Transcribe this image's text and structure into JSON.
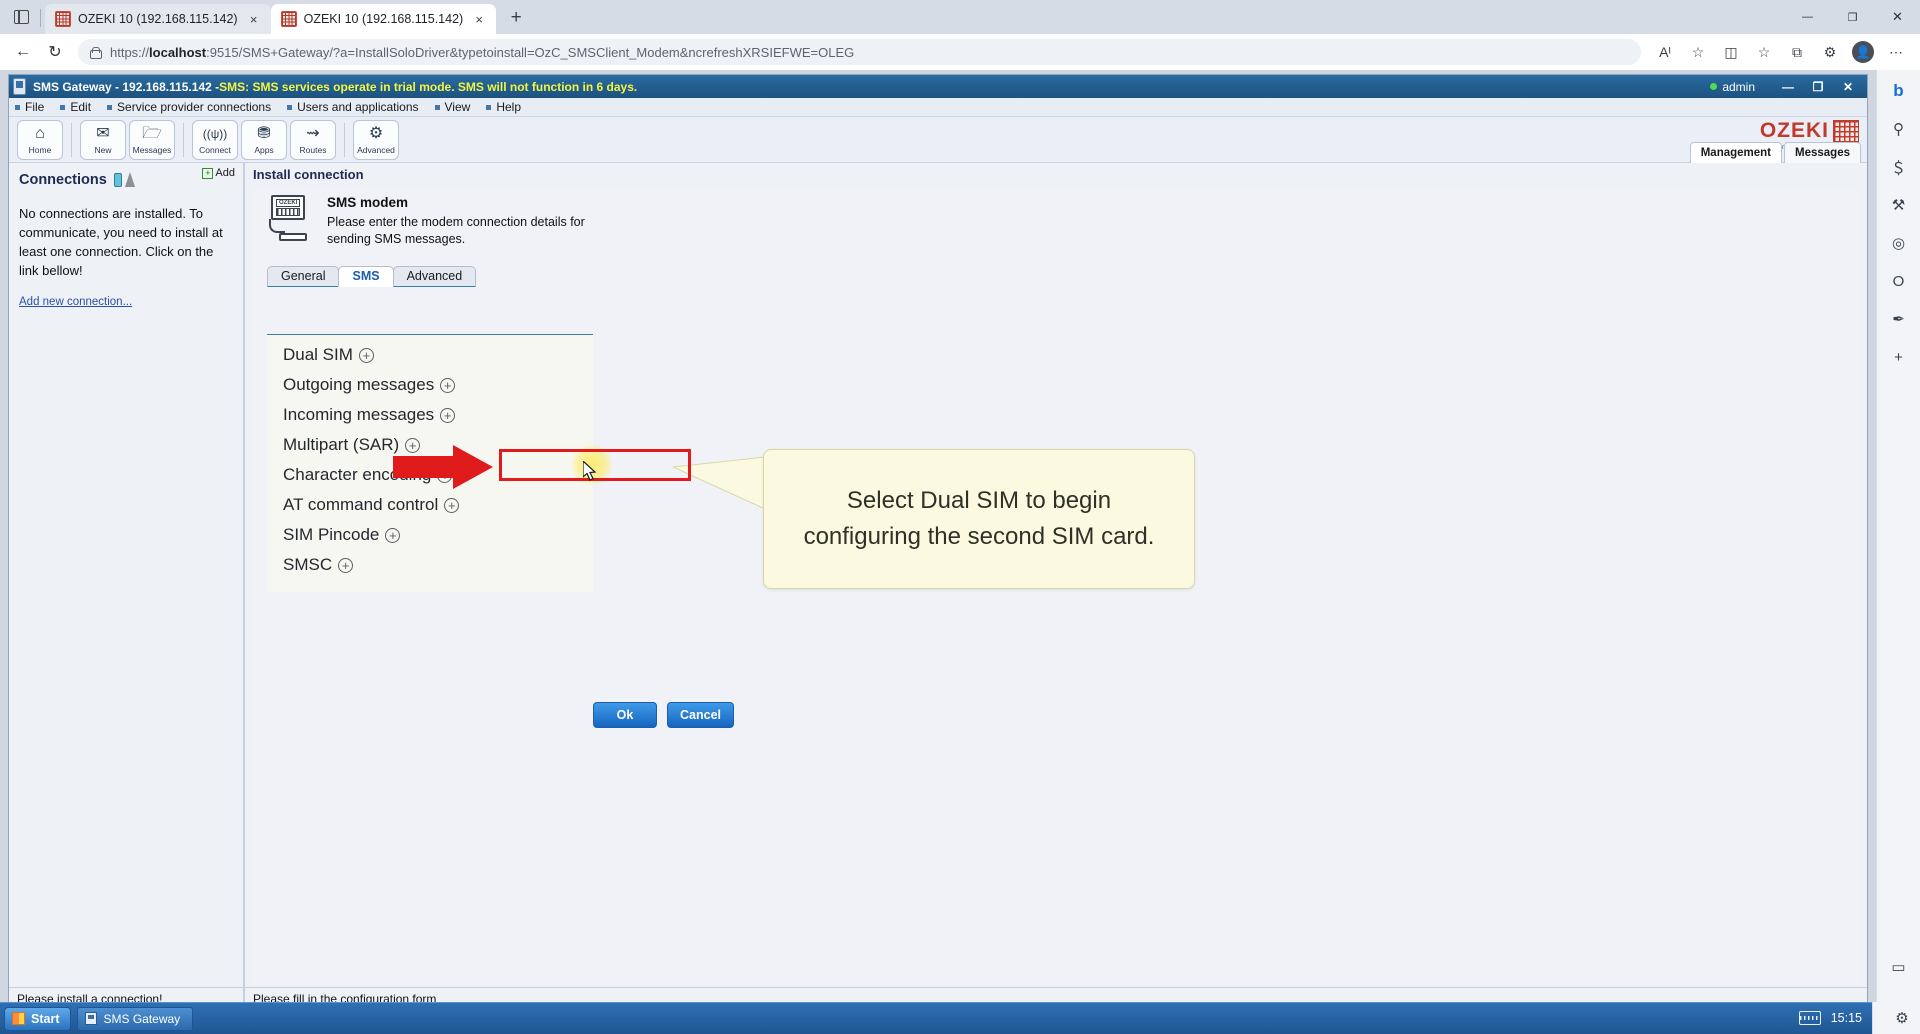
{
  "browser": {
    "tabs": [
      {
        "title": "OZEKI 10 (192.168.115.142)",
        "active": false
      },
      {
        "title": "OZEKI 10 (192.168.115.142)",
        "active": true
      }
    ],
    "new_tab_label": "+",
    "close_glyph": "×",
    "window_controls": {
      "minimize": "—",
      "maximize": "❐",
      "close": "✕"
    },
    "nav": {
      "back": "←",
      "reload": "↻"
    },
    "address": {
      "scheme": "https://",
      "host": "localhost",
      "rest": ":9515/SMS+Gateway/?a=InstallSoloDriver&typetoinstall=OzC_SMSClient_Modem&ncrefreshXRSIEFWE=OLEG",
      "full": "https://localhost:9515/SMS+Gateway/?a=InstallSoloDriver&typetoinstall=OzC_SMSClient_Modem&ncrefreshXRSIEFWE=OLEG"
    },
    "nav_icons": [
      {
        "name": "read-aloud-icon",
        "glyph": "Aᴵ"
      },
      {
        "name": "favorite-star-icon",
        "glyph": "☆"
      },
      {
        "name": "split-screen-icon",
        "glyph": "◫"
      },
      {
        "name": "favorites-icon",
        "glyph": "☆"
      },
      {
        "name": "collections-icon",
        "glyph": "⧉"
      },
      {
        "name": "browser-essentials-icon",
        "glyph": "⚙"
      },
      {
        "name": "profile-icon",
        "glyph": "●"
      },
      {
        "name": "settings-more-icon",
        "glyph": "⋯"
      }
    ],
    "edge_sidebar": [
      {
        "name": "copilot-icon",
        "glyph": "b"
      },
      {
        "name": "search-icon",
        "glyph": "⚲"
      },
      {
        "name": "shopping-icon",
        "glyph": "＄"
      },
      {
        "name": "tools-icon",
        "glyph": "⚒"
      },
      {
        "name": "games-icon",
        "glyph": "◎"
      },
      {
        "name": "outlook-icon",
        "glyph": "O"
      },
      {
        "name": "drop-icon",
        "glyph": "✒"
      },
      {
        "name": "add-tool-icon",
        "glyph": "+"
      },
      {
        "name": "phone-link-icon",
        "glyph": "▭"
      },
      {
        "name": "sidebar-settings-icon",
        "glyph": "⚙"
      }
    ]
  },
  "app": {
    "title_prefix": "SMS Gateway - 192.168.115.142 - ",
    "title_warning": "SMS: SMS services operate in trial mode. SMS will not function in 6 days.",
    "user": "admin",
    "window_controls": {
      "minimize": "—",
      "maximize": "❐",
      "close": "✕"
    },
    "menu": [
      {
        "label": "File"
      },
      {
        "label": "Edit"
      },
      {
        "label": "Service provider connections"
      },
      {
        "label": "Users and applications"
      },
      {
        "label": "View"
      },
      {
        "label": "Help"
      }
    ],
    "toolbar": [
      {
        "label": "Home",
        "icon": "home-icon",
        "glyph": "⌂"
      },
      {
        "label": "New",
        "icon": "new-message-icon",
        "glyph": "✉"
      },
      {
        "label": "Messages",
        "icon": "messages-folder-icon",
        "glyph": "▱"
      },
      {
        "label": "Connect",
        "icon": "antenna-icon",
        "glyph": "((ψ))"
      },
      {
        "label": "Apps",
        "icon": "database-icon",
        "glyph": "⛃"
      },
      {
        "label": "Routes",
        "icon": "routes-icon",
        "glyph": "⇥"
      },
      {
        "label": "Advanced",
        "icon": "gear-icon",
        "glyph": "⚙"
      }
    ],
    "mgmt_tabs": [
      {
        "label": "Management",
        "selected": true
      },
      {
        "label": "Messages",
        "selected": false
      }
    ],
    "logo": {
      "name": "OZEKI",
      "url": "www.myozeki.com"
    }
  },
  "sidebar": {
    "heading": "Connections",
    "add_label": "Add",
    "add_plus": "+",
    "message": "No connections are installed. To communicate, you need to install at least one connection. Click on the link bellow!",
    "link": "Add new connection...",
    "status": "Please install a connection!"
  },
  "main": {
    "panel_title": "Install connection",
    "modem": {
      "title": "SMS modem",
      "description": "Please enter the modem connection details for sending SMS messages."
    },
    "tabs": [
      {
        "label": "General",
        "selected": false
      },
      {
        "label": "SMS",
        "selected": true
      },
      {
        "label": "Advanced",
        "selected": false
      }
    ],
    "accordion": [
      {
        "label": "Dual SIM",
        "expander": "+",
        "highlighted": true
      },
      {
        "label": "Outgoing messages",
        "expander": "+",
        "highlighted": false
      },
      {
        "label": "Incoming messages",
        "expander": "+",
        "highlighted": false
      },
      {
        "label": "Multipart (SAR)",
        "expander": "+",
        "highlighted": false
      },
      {
        "label": "Character encoding",
        "expander": "+",
        "highlighted": false
      },
      {
        "label": "AT command control",
        "expander": "+",
        "highlighted": false
      },
      {
        "label": "SIM Pincode",
        "expander": "+",
        "highlighted": false
      },
      {
        "label": "SMSC",
        "expander": "+",
        "highlighted": false
      }
    ],
    "buttons": {
      "ok": "Ok",
      "cancel": "Cancel"
    },
    "status": "Please fill in the configuration form",
    "callout": "Select Dual SIM to begin configuring the second SIM card.",
    "annotation_color": "#e01b1b",
    "highlight_color": "#ffeb5a"
  },
  "taskbar": {
    "start": "Start",
    "items": [
      {
        "label": "SMS Gateway"
      }
    ],
    "clock": "15:15"
  }
}
